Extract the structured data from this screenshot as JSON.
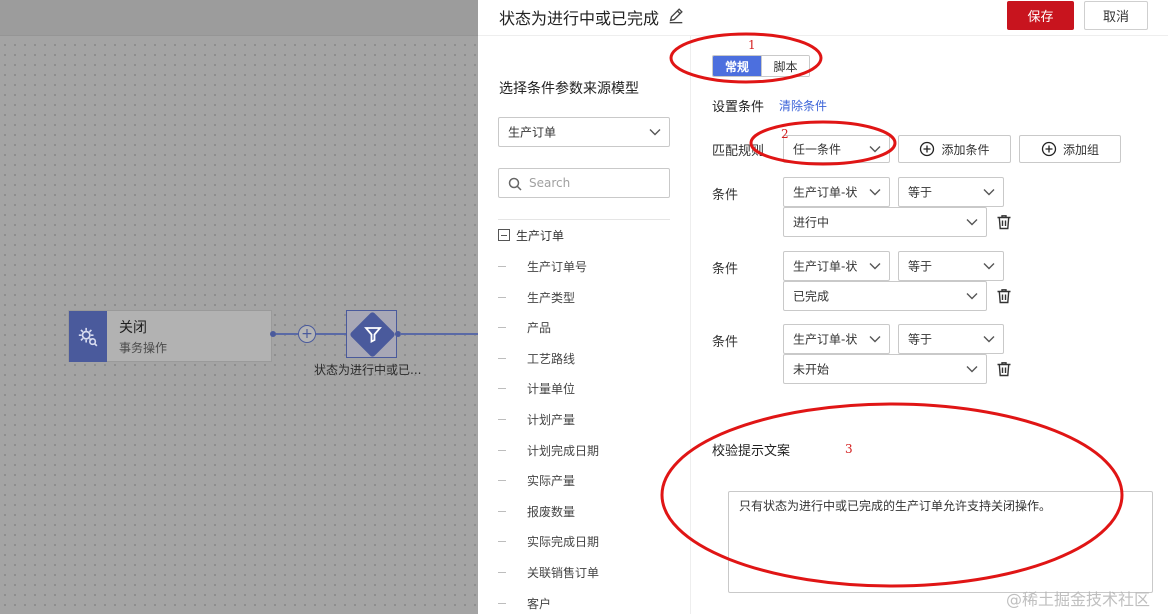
{
  "canvas": {
    "node_close": {
      "title": "关闭",
      "subtitle": "事务操作",
      "icon": "gear-search-icon"
    },
    "filter_node": {
      "label": "状态为进行中或已...",
      "icon": "funnel-icon"
    },
    "add_icon": "+"
  },
  "header": {
    "title": "状态为进行中或已完成",
    "edit_icon": "pencil-icon",
    "save_label": "保存",
    "cancel_label": "取消",
    "save_color": "#c8141e"
  },
  "left_panel": {
    "title": "选择条件参数来源模型",
    "model_select": "生产订单",
    "search_placeholder": "Search",
    "tree_root": "生产订单",
    "tree_items": [
      "生产订单号",
      "生产类型",
      "产品",
      "工艺路线",
      "计量单位",
      "计划产量",
      "计划完成日期",
      "实际产量",
      "报废数量",
      "实际完成日期",
      "关联销售订单",
      "客户"
    ]
  },
  "tabs": [
    {
      "label": "常规",
      "active": true
    },
    {
      "label": "脚本",
      "active": false
    }
  ],
  "conditions_section": {
    "title": "设置条件",
    "clear_link": "清除条件",
    "match_label": "匹配规则",
    "match_value": "任一条件",
    "add_condition": "添加条件",
    "add_group": "添加组",
    "condition_label": "条件",
    "rows": [
      {
        "field": "生产订单-状",
        "operator": "等于",
        "value": "进行中"
      },
      {
        "field": "生产订单-状",
        "operator": "等于",
        "value": "已完成"
      },
      {
        "field": "生产订单-状",
        "operator": "等于",
        "value": "未开始"
      }
    ]
  },
  "message_section": {
    "title": "校验提示文案",
    "text": "只有状态为进行中或已完成的生产订单允许支持关闭操作。"
  },
  "annotations": {
    "numbers": [
      "1",
      "2",
      "3"
    ],
    "color": "#e01515"
  },
  "watermark": "@稀土掘金技术社区",
  "accent_color": "#4c6fde"
}
